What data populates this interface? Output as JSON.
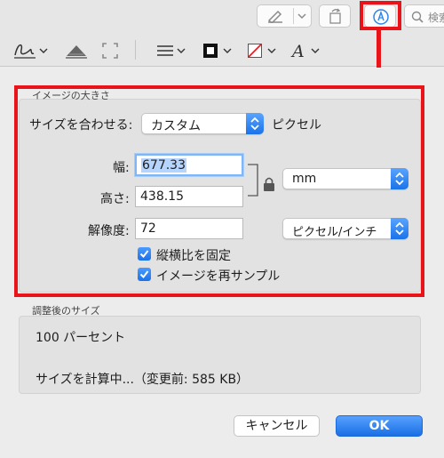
{
  "toolbar": {
    "search_placeholder": "検索"
  },
  "image_size": {
    "group_title": "イメージの大きさ",
    "fit_label": "サイズを合わせる:",
    "fit_value": "カスタム",
    "fit_unit": "ピクセル",
    "width_label": "幅:",
    "width_value": "677.33",
    "height_label": "高さ:",
    "height_value": "438.15",
    "unit_value": "mm",
    "resolution_label": "解像度:",
    "resolution_value": "72",
    "resolution_unit_value": "ピクセル/インチ",
    "scale_proportionally_label": "縦横比を固定",
    "resample_label": "イメージを再サンプル"
  },
  "result_size": {
    "group_title": "調整後のサイズ",
    "percent_text": "100 パーセント",
    "calc_text": "サイズを計算中...（変更前: 585 KB）"
  },
  "buttons": {
    "cancel_label": "キャンセル",
    "ok_label": "OK"
  },
  "colors": {
    "annotation_red": "#e8141a",
    "accent_blue": "#1a73e8"
  }
}
